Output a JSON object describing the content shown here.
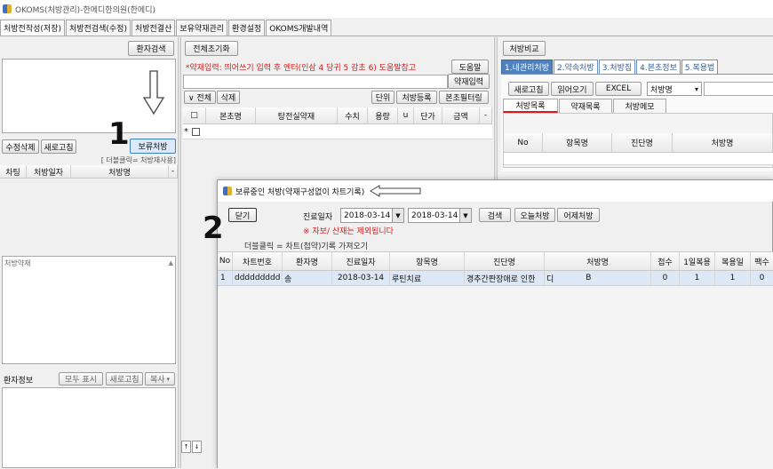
{
  "window": {
    "title": "OKOMS(처방관리)-한메디한의원(한메디)"
  },
  "menu": [
    "처방전작성(저장)",
    "처방전검색(수정)",
    "처방전결산",
    "보유약재관리",
    "환경설정",
    "OKOMS개발내역"
  ],
  "left": {
    "patient_search": "환자검색",
    "edit_delete": "수정삭제",
    "refresh": "새로고침",
    "hold_rx": "보류처방",
    "dblclick_hint": "[ 더블클릭= 처방재사용]",
    "cols": [
      "차팅",
      "처방일자",
      "처방명"
    ],
    "herb_label": "처방약재",
    "patient_info": "환자정보",
    "show_all": "모두 표시",
    "refresh2": "새로고침",
    "copy": "복사"
  },
  "annot": {
    "one": "1",
    "two": "2"
  },
  "middle": {
    "reset_all": "전체초기화",
    "hint": "*약재입력: 띄어쓰기 입력 후 엔터(인삼 4 당귀 5 감초 6) 도움말참고",
    "help": "도움말",
    "herb_input": "약재입력",
    "all": "∨ 전체",
    "delete": "삭제",
    "unit": "단위",
    "rx_register": "처방등록",
    "filter": "본초필터링",
    "cols": [
      "□",
      "본초명",
      "탕전실약재",
      "수치",
      "용량",
      "u",
      "단가",
      "금액",
      "-"
    ],
    "row_marker": "*"
  },
  "right": {
    "compare": "처방비교",
    "tabs": [
      "1.내관리처방",
      "2.약속처방",
      "3.처방집",
      "4.본초정보",
      "5.복용법"
    ],
    "refresh": "새로고침",
    "load": "읽어오기",
    "excel": "EXCEL",
    "rx_name_select": "처방명",
    "subtabs": [
      "처방목록",
      "약재목록",
      "처방메모"
    ],
    "cols": [
      "No",
      "항목명",
      "진단명",
      "처방명"
    ]
  },
  "dialog": {
    "title": "보류중인 처방(약재구성없이 차트기록)",
    "close": "닫기",
    "date_label": "진료일자",
    "date_from": "2018-03-14",
    "date_to": "2018-03-14",
    "search": "검색",
    "today_rx": "오늘처방",
    "yesterday_rx": "어제처방",
    "warning": "※ 자보/ 산재는 제외됩니다",
    "dbl_hint": "더블클릭 = 차트(첩약)기록 가져오기",
    "cols": [
      "No",
      "차트번호",
      "환자명",
      "진료일자",
      "항목명",
      "진단명",
      "처방명",
      "첩수",
      "1일복용",
      "복용일",
      "팩수"
    ],
    "rows": [
      [
        "1",
        "ddddddddd",
        "송",
        "2018-03-14",
        "루틴치료",
        "경추간판장애로 인한",
        "디",
        "B",
        "0",
        "1",
        "1",
        "0"
      ]
    ]
  }
}
